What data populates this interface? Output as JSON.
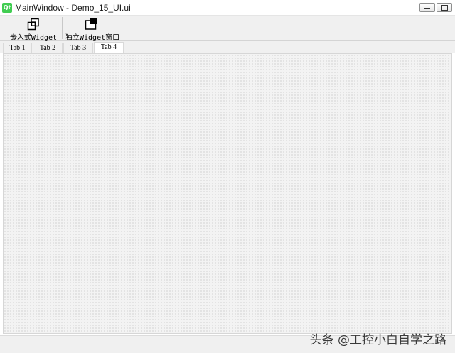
{
  "window": {
    "app_icon_text": "Qt",
    "title": "MainWindow - Demo_15_UI.ui"
  },
  "toolbar": {
    "embedded_widget_label": "嵌入式Widget",
    "standalone_window_label": "独立Widget窗口"
  },
  "tabs": [
    {
      "label": "Tab 1",
      "active": false
    },
    {
      "label": "Tab 2",
      "active": false
    },
    {
      "label": "Tab 3",
      "active": false
    },
    {
      "label": "Tab 4",
      "active": true
    }
  ],
  "watermark": "头条 @工控小白自学之路",
  "colors": {
    "qt_green": "#41cd52",
    "chrome": "#f0f0f0",
    "active_tab": "#ffffff"
  }
}
